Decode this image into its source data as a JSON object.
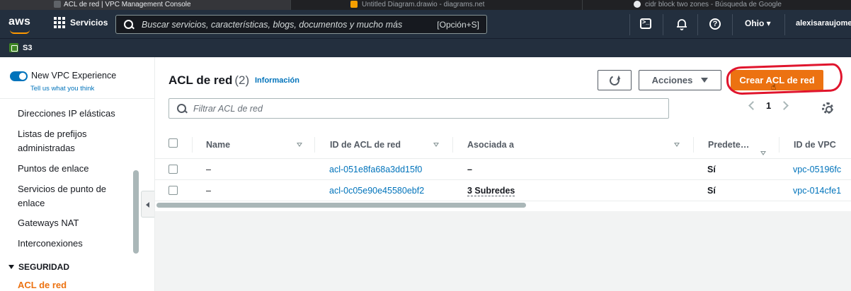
{
  "browser_tabs": [
    {
      "title": "ACL de red | VPC Management Console"
    },
    {
      "title": "Untitled Diagram.drawio - diagrams.net"
    },
    {
      "title": "cidr block two zones - Búsqueda de Google"
    }
  ],
  "topnav": {
    "logo": "aws",
    "services_label": "Servicios",
    "search_placeholder": "Buscar servicios, características, blogs, documentos y mucho más",
    "search_shortcut": "[Opción+S]",
    "region": "Ohio ▾",
    "user": "alexisaraujome"
  },
  "favorites": [
    {
      "label": "S3"
    }
  ],
  "sidebar": {
    "toggle_label": "New VPC Experience",
    "feedback_link": "Tell us what you think",
    "items": [
      {
        "label": "Direcciones IP elásticas"
      },
      {
        "label": "Listas de prefijos administradas"
      },
      {
        "label": "Puntos de enlace"
      },
      {
        "label": "Servicios de punto de enlace"
      },
      {
        "label": "Gateways NAT"
      },
      {
        "label": "Interconexiones"
      }
    ],
    "section": "SEGURIDAD",
    "active_item": "ACL de red"
  },
  "panel": {
    "title": "ACL de red",
    "count": "(2)",
    "info_link": "Información",
    "actions_label": "Acciones",
    "create_label": "Crear ACL de red",
    "filter_placeholder": "Filtrar ACL de red",
    "page_number": "1"
  },
  "table": {
    "columns": [
      {
        "label": "Name"
      },
      {
        "label": "ID de ACL de red"
      },
      {
        "label": "Asociada a"
      },
      {
        "label": "Predete…"
      },
      {
        "label": "ID de VPC"
      }
    ],
    "rows": [
      {
        "name": "–",
        "acl_id": "acl-051e8fa68a3dd15f0",
        "associated": "–",
        "default": "Sí",
        "vpc_id": "vpc-05196fc"
      },
      {
        "name": "–",
        "acl_id": "acl-0c05e90e45580ebf2",
        "associated": "3 Subredes",
        "default": "Sí",
        "vpc_id": "vpc-014cfe1"
      }
    ]
  },
  "colors": {
    "aws_nav": "#232f3e",
    "primary_orange": "#ec7211",
    "link_blue": "#0073bb",
    "annotation_red": "#e0152d"
  }
}
